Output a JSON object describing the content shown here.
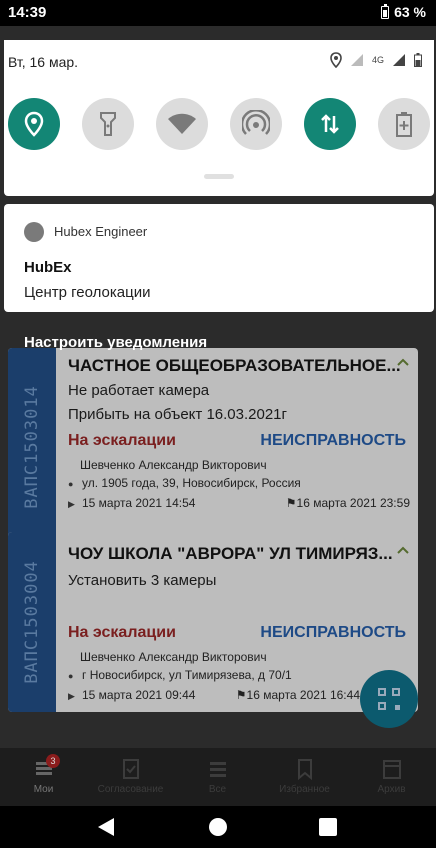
{
  "status_bar": {
    "time": "14:39",
    "battery": "63 %"
  },
  "quick_settings": {
    "date": "Вт, 16 мар.",
    "network": "4G",
    "tiles": [
      {
        "icon": "location-icon",
        "active": true
      },
      {
        "icon": "flashlight-icon",
        "active": false
      },
      {
        "icon": "wifi-icon",
        "active": false
      },
      {
        "icon": "hotspot-icon",
        "active": false
      },
      {
        "icon": "mobile-data-icon",
        "active": true
      },
      {
        "icon": "battery-saver-icon",
        "active": false
      }
    ]
  },
  "notification": {
    "app_name": "Hubex Engineer",
    "title": "HubEx",
    "text": "Центр геолокации"
  },
  "manage_notifications_label": "Настроить уведомления",
  "tasks": [
    {
      "id": "ВАПС1503014",
      "title": "ЧАСТНОЕ ОБЩЕОБРАЗОВАТЕЛЬНОЕ...",
      "desc": "Не работает камера",
      "desc2": "Прибыть на объект 16.03.2021г",
      "status": "На эскалации",
      "type": "НЕИСПРАВНОСТЬ",
      "assignee": "Шевченко Александр Викторович",
      "address": "ул. 1905 года, 39, Новосибирск, Россия",
      "start": "15 марта 2021 14:54",
      "end": "16 марта 2021 23:59"
    },
    {
      "id": "ВАПС1503004",
      "title": "ЧОУ ШКОЛА \"АВРОРА\"  УЛ ТИМИРЯЗ...",
      "desc": "Установить 3 камеры",
      "desc2": "",
      "status": "На эскалации",
      "type": "НЕИСПРАВНОСТЬ",
      "assignee": "Шевченко Александр Викторович",
      "address": "г Новосибирск, ул Тимирязева, д 70/1",
      "start": "15 марта 2021 09:44",
      "end": "16 марта 2021 16:44"
    }
  ],
  "bottom_nav": [
    {
      "label": "Мои",
      "badge": "3"
    },
    {
      "label": "Согласование"
    },
    {
      "label": "Все"
    },
    {
      "label": "Избранное"
    },
    {
      "label": "Архив"
    }
  ]
}
